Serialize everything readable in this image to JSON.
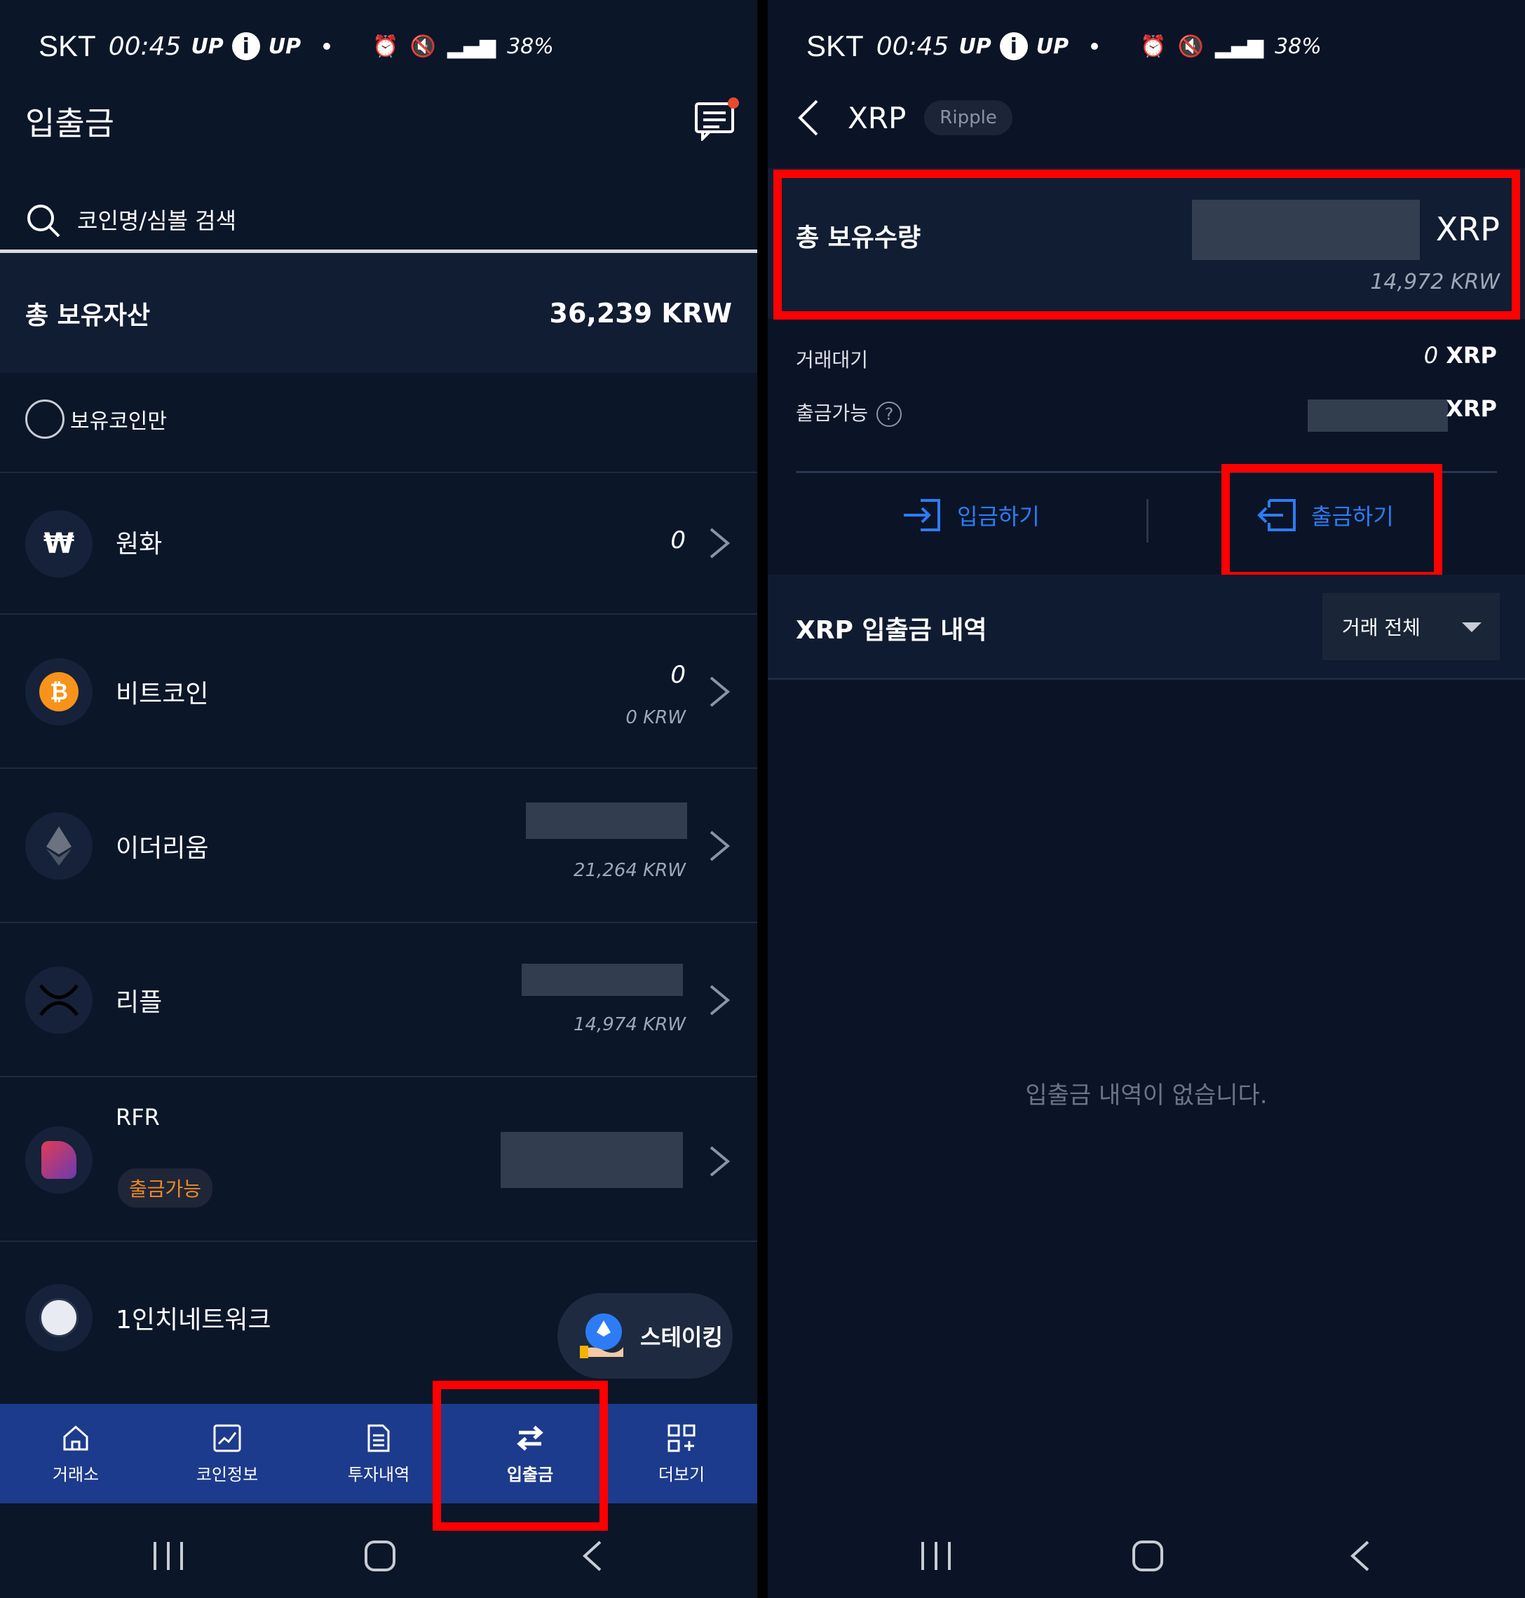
{
  "status_bar": {
    "carrier": "SKT",
    "time": "00:45",
    "up1": "UP",
    "info": "i",
    "up2": "UP",
    "battery": "38%"
  },
  "left": {
    "title": "입출금",
    "search_placeholder": "코인명/심볼 검색",
    "total_label": "총 보유자산",
    "total_value": "36,239 KRW",
    "filter_label": "보유코인만",
    "coins": [
      {
        "name": "원화",
        "value": "0",
        "krw": ""
      },
      {
        "name": "비트코인",
        "value": "0",
        "krw": "0 KRW"
      },
      {
        "name": "이더리움",
        "value": "",
        "krw": "21,264 KRW"
      },
      {
        "name": "리플",
        "value": "",
        "krw": "14,974 KRW"
      },
      {
        "name": "RFR",
        "value": "",
        "krw": "",
        "badge": "출금가능"
      },
      {
        "name": "1인치네트워크",
        "value": "",
        "krw": ""
      }
    ],
    "staking_label": "스테이킹",
    "tabs": [
      {
        "label": "거래소",
        "icon": "home-icon"
      },
      {
        "label": "코인정보",
        "icon": "chart-icon"
      },
      {
        "label": "투자내역",
        "icon": "document-icon"
      },
      {
        "label": "입출금",
        "icon": "transfer-icon",
        "active": true
      },
      {
        "label": "더보기",
        "icon": "grid-plus-icon"
      }
    ]
  },
  "right": {
    "symbol": "XRP",
    "name": "Ripple",
    "holdings_label": "총 보유수량",
    "holdings_unit": "XRP",
    "holdings_krw": "14,972 KRW",
    "pending_label": "거래대기",
    "pending_value": "0",
    "pending_unit": "XRP",
    "withdrawable_label": "출금가능",
    "withdrawable_help": "?",
    "withdrawable_unit": "XRP",
    "deposit_label": "입금하기",
    "withdraw_label": "출금하기",
    "history_title": "XRP 입출금 내역",
    "filter_value": "거래 전체",
    "empty_message": "입출금 내역이 없습니다."
  },
  "colors": {
    "background": "#0b1629",
    "accent_blue": "#2d7cf6",
    "tabbar": "#1d3b8c",
    "highlight_red": "#ff0000",
    "badge_orange": "#f08a22"
  }
}
